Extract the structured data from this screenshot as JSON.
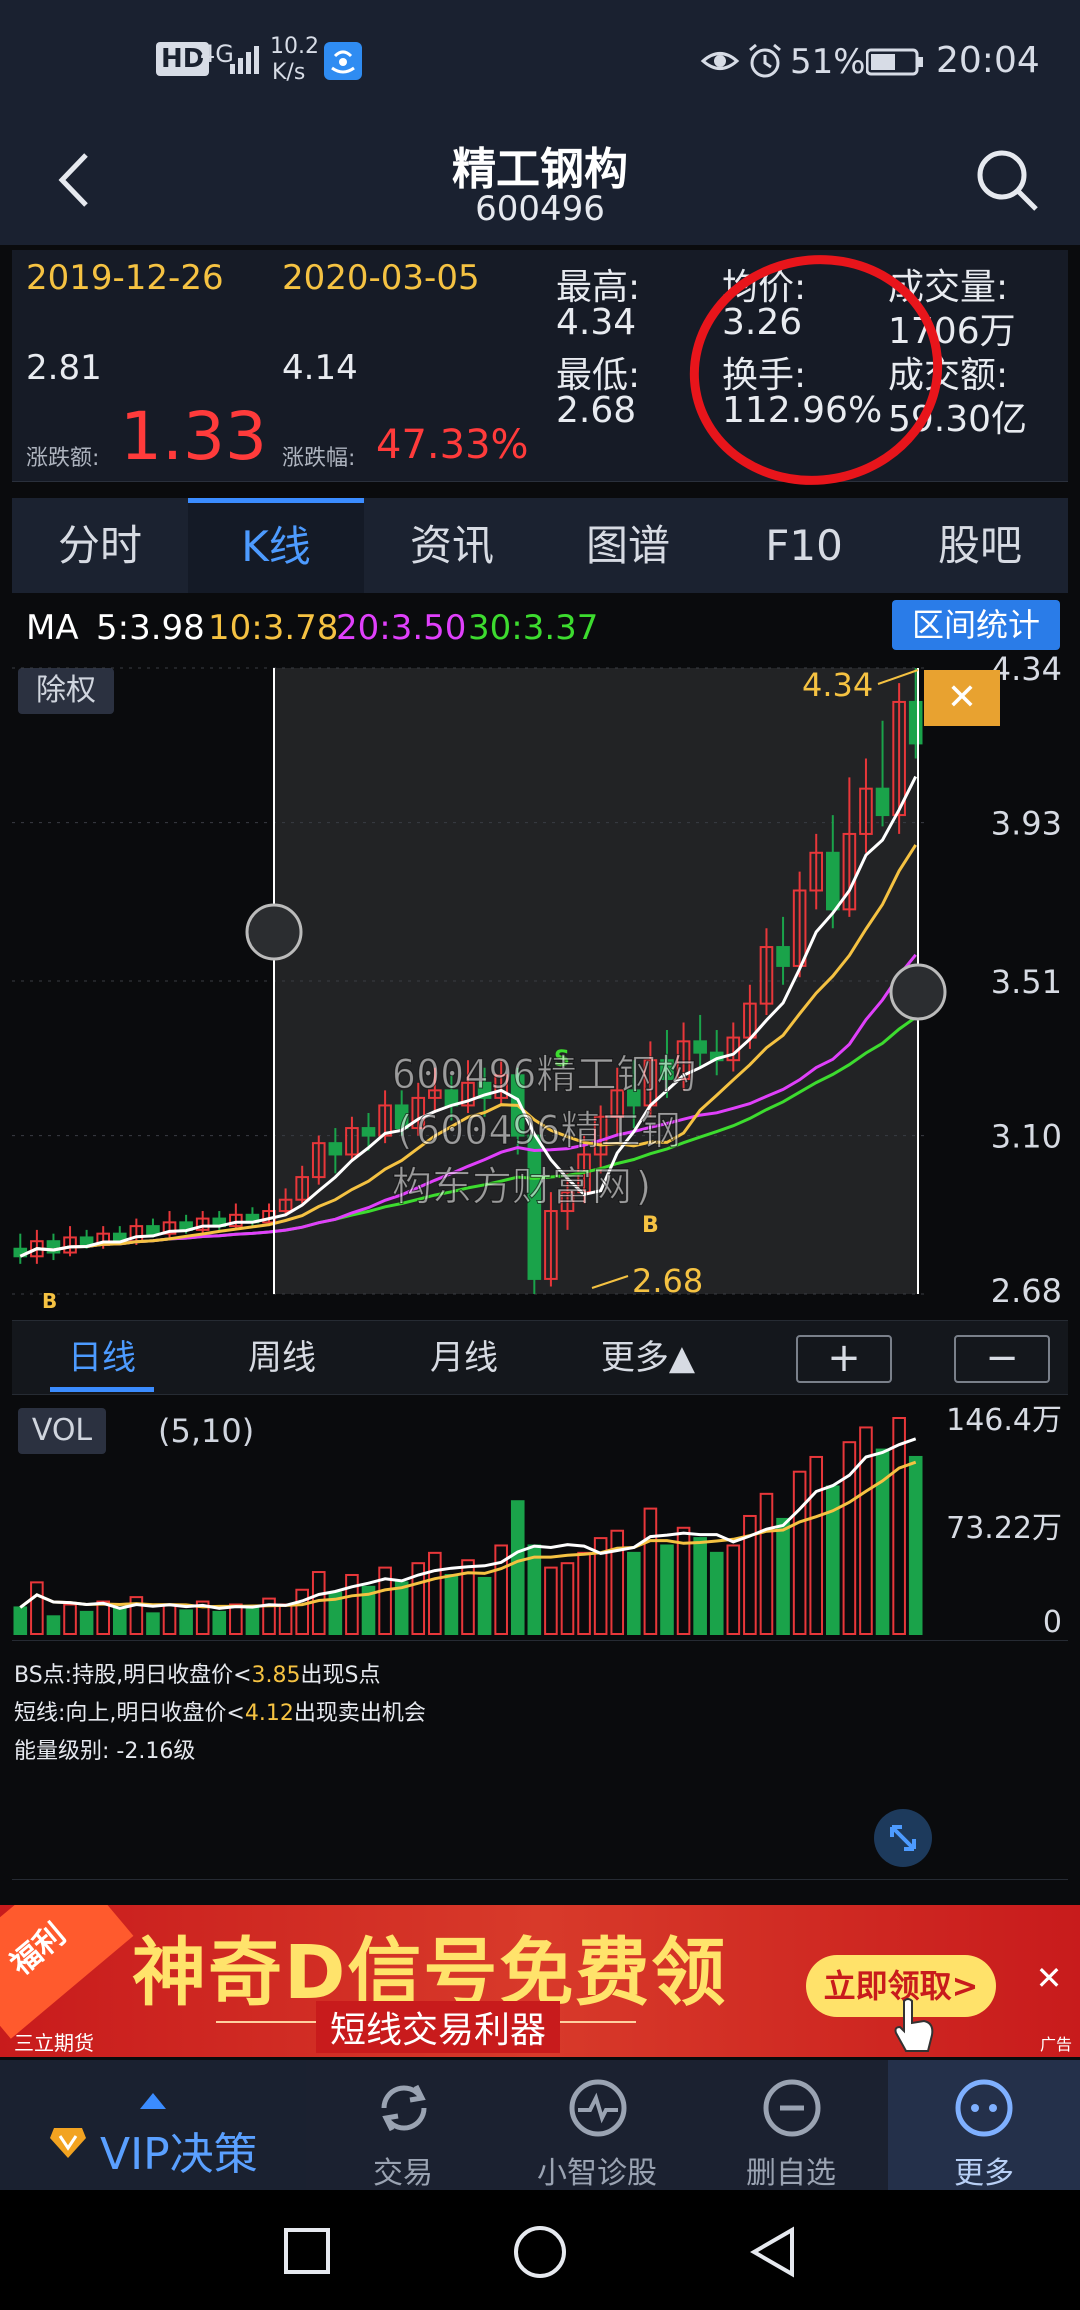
{
  "status_bar": {
    "hd": "HD",
    "net": "4G",
    "speed_value": "10.2",
    "speed_unit": "K/s",
    "battery": "51%",
    "time": "20:04"
  },
  "header": {
    "title": "精工钢构",
    "code": "600496"
  },
  "quote": {
    "start_date": "2019-12-26",
    "end_date": "2020-03-05",
    "start_price": "2.81",
    "end_price": "4.14",
    "change_label": "涨跌额:",
    "change_value": "1.33",
    "pct_label": "涨跌幅:",
    "pct_value": "47.33%",
    "high_label": "最高:",
    "high_value": "4.34",
    "low_label": "最低:",
    "low_value": "2.68",
    "avg_label": "均价:",
    "avg_value": "3.26",
    "turnover_label": "换手:",
    "turnover_value": "112.96%",
    "volume_label": "成交量:",
    "volume_value": "1706万",
    "amount_label": "成交额:",
    "amount_value": "59.30亿"
  },
  "tabs": [
    "分时",
    "K线",
    "资讯",
    "图谱",
    "F10",
    "股吧"
  ],
  "ma_bar": {
    "ma": "MA",
    "ma5": "5:3.98",
    "ma10": "10:3.78",
    "ma20": "20:3.50",
    "ma30": "30:3.37",
    "range_button": "区间统计",
    "exright": "除权",
    "close": "✕"
  },
  "chart_data": {
    "type": "candlestick",
    "y_ticks": [
      "4.34",
      "3.93",
      "3.51",
      "3.10",
      "2.68"
    ],
    "ylim": [
      2.68,
      4.34
    ],
    "high_label": "4.34",
    "low_label": "2.68",
    "markers": [
      "S",
      "B",
      "B"
    ],
    "watermark": "600496精工钢构(600496精工钢构东方财富网)",
    "candles": [
      [
        2.8,
        2.78,
        2.84,
        2.76
      ],
      [
        2.78,
        2.82,
        2.85,
        2.76
      ],
      [
        2.82,
        2.79,
        2.84,
        2.77
      ],
      [
        2.79,
        2.83,
        2.86,
        2.78
      ],
      [
        2.83,
        2.81,
        2.85,
        2.8
      ],
      [
        2.81,
        2.84,
        2.86,
        2.8
      ],
      [
        2.84,
        2.82,
        2.86,
        2.81
      ],
      [
        2.82,
        2.86,
        2.88,
        2.81
      ],
      [
        2.86,
        2.84,
        2.88,
        2.83
      ],
      [
        2.84,
        2.87,
        2.9,
        2.83
      ],
      [
        2.87,
        2.85,
        2.89,
        2.84
      ],
      [
        2.85,
        2.88,
        2.9,
        2.84
      ],
      [
        2.88,
        2.86,
        2.9,
        2.85
      ],
      [
        2.86,
        2.89,
        2.92,
        2.85
      ],
      [
        2.89,
        2.87,
        2.91,
        2.86
      ],
      [
        2.87,
        2.9,
        2.92,
        2.86
      ],
      [
        2.9,
        2.93,
        2.96,
        2.89
      ],
      [
        2.93,
        2.99,
        3.02,
        2.92
      ],
      [
        2.99,
        3.08,
        3.1,
        2.97
      ],
      [
        3.08,
        3.05,
        3.12,
        3.0
      ],
      [
        3.05,
        3.12,
        3.15,
        3.03
      ],
      [
        3.12,
        3.1,
        3.16,
        3.06
      ],
      [
        3.1,
        3.18,
        3.22,
        3.08
      ],
      [
        3.18,
        3.12,
        3.22,
        3.1
      ],
      [
        3.12,
        3.2,
        3.24,
        3.1
      ],
      [
        3.2,
        3.22,
        3.28,
        3.16
      ],
      [
        3.22,
        3.18,
        3.26,
        3.14
      ],
      [
        3.18,
        3.24,
        3.3,
        3.16
      ],
      [
        3.24,
        3.2,
        3.28,
        3.15
      ],
      [
        3.2,
        3.26,
        3.3,
        3.18
      ],
      [
        3.26,
        3.1,
        3.28,
        3.05
      ],
      [
        3.1,
        2.72,
        3.1,
        2.68
      ],
      [
        2.72,
        2.9,
        2.95,
        2.7
      ],
      [
        2.9,
        2.95,
        3.0,
        2.85
      ],
      [
        2.95,
        3.05,
        3.1,
        2.92
      ],
      [
        3.05,
        3.15,
        3.18,
        3.0
      ],
      [
        3.15,
        3.22,
        3.28,
        3.1
      ],
      [
        3.22,
        3.18,
        3.3,
        3.12
      ],
      [
        3.18,
        3.3,
        3.35,
        3.15
      ],
      [
        3.3,
        3.25,
        3.38,
        3.2
      ],
      [
        3.25,
        3.35,
        3.4,
        3.22
      ],
      [
        3.35,
        3.32,
        3.42,
        3.28
      ],
      [
        3.32,
        3.3,
        3.38,
        3.26
      ],
      [
        3.3,
        3.36,
        3.4,
        3.27
      ],
      [
        3.36,
        3.45,
        3.5,
        3.33
      ],
      [
        3.45,
        3.6,
        3.65,
        3.42
      ],
      [
        3.6,
        3.55,
        3.68,
        3.5
      ],
      [
        3.55,
        3.75,
        3.8,
        3.52
      ],
      [
        3.75,
        3.85,
        3.9,
        3.7
      ],
      [
        3.85,
        3.7,
        3.95,
        3.65
      ],
      [
        3.7,
        3.9,
        4.05,
        3.68
      ],
      [
        3.9,
        4.02,
        4.1,
        3.85
      ],
      [
        4.02,
        3.95,
        4.2,
        3.92
      ],
      [
        3.95,
        4.25,
        4.3,
        3.9
      ],
      [
        4.25,
        4.14,
        4.34,
        4.1
      ]
    ]
  },
  "period_tabs": [
    "日线",
    "周线",
    "月线",
    "更多▲"
  ],
  "zoom": {
    "plus": "+",
    "minus": "−"
  },
  "volume": {
    "label": "VOL",
    "params": "(5,10)",
    "ticks": [
      "146.4万",
      "73.22万",
      "0"
    ],
    "ylim": [
      0,
      146.4
    ],
    "values": [
      18,
      35,
      12,
      20,
      15,
      22,
      18,
      25,
      14,
      20,
      16,
      22,
      15,
      20,
      18,
      24,
      20,
      30,
      42,
      28,
      40,
      32,
      45,
      35,
      48,
      55,
      40,
      50,
      38,
      60,
      90,
      60,
      45,
      48,
      55,
      65,
      70,
      55,
      85,
      60,
      72,
      65,
      55,
      60,
      80,
      95,
      78,
      110,
      120,
      100,
      130,
      140,
      125,
      146.4,
      120
    ]
  },
  "notes": {
    "bs_pre": "BS点:持股,明日收盘价<",
    "bs_val": "3.85",
    "bs_post": "出现S点",
    "short_pre": "短线:向上,明日收盘价<",
    "short_val": "4.12",
    "short_post": "出现卖出机会",
    "energy": "能量级别: -2.16级"
  },
  "ad": {
    "corner": "福利",
    "brand": "三立期货",
    "headline": "神奇D信号免费领",
    "subline": "短线交易利器",
    "cta": "立即领取>",
    "tag": "广告",
    "close": "✕"
  },
  "bottom_nav": {
    "vip": "VIP决策",
    "items": [
      "交易",
      "小智诊股",
      "删自选",
      "更多"
    ]
  },
  "colors": {
    "up": "#e8373a",
    "down": "#1aa34a",
    "ma5": "#ffffff",
    "ma10": "#f5c242",
    "ma20": "#e040fb",
    "ma30": "#3ddc2f",
    "accent": "#3b8cff"
  }
}
